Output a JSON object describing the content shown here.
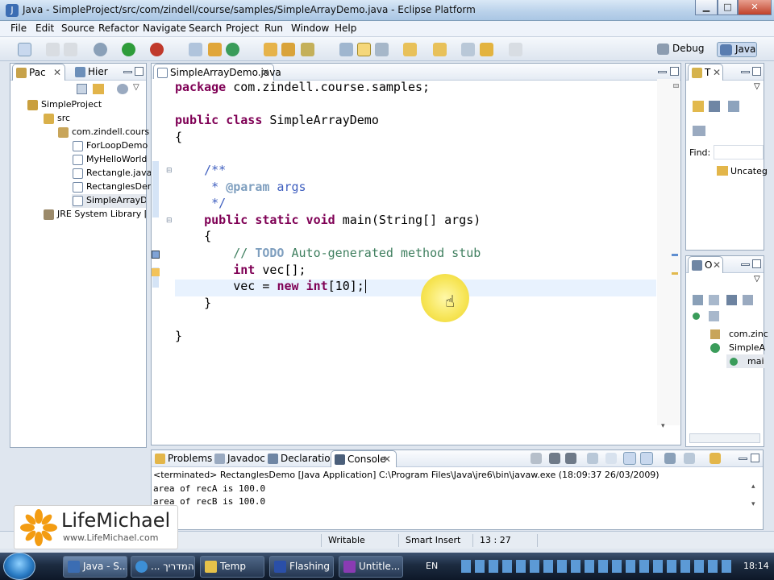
{
  "window": {
    "title": "Java - SimpleProject/src/com/zindell/course/samples/SimpleArrayDemo.java - Eclipse Platform",
    "minimize": "▁",
    "maximize": "□",
    "close": "✕"
  },
  "menu": [
    "File",
    "Edit",
    "Source",
    "Refactor",
    "Navigate",
    "Search",
    "Project",
    "Run",
    "Window",
    "Help"
  ],
  "perspectives": {
    "debug": "Debug",
    "java": "Java"
  },
  "package_explorer": {
    "tabs": [
      "Pac",
      "Hier"
    ],
    "tree": [
      {
        "label": "SimpleProject",
        "icon": "project-icon"
      },
      {
        "label": "src",
        "icon": "source-folder-icon"
      },
      {
        "label": "com.zindell.cours",
        "icon": "package-icon"
      },
      {
        "label": "ForLoopDemo",
        "icon": "java-file-icon"
      },
      {
        "label": "MyHelloWorld",
        "icon": "java-file-icon"
      },
      {
        "label": "Rectangle.java",
        "icon": "java-file-icon"
      },
      {
        "label": "RectanglesDer",
        "icon": "java-file-icon"
      },
      {
        "label": "SimpleArrayDe",
        "icon": "java-file-icon"
      },
      {
        "label": "JRE System Library [jre",
        "icon": "library-icon"
      }
    ]
  },
  "editor": {
    "tab": "SimpleArrayDemo.java",
    "code": {
      "l1_kw": "package",
      "l1_rest": " com.zindell.course.samples;",
      "l3_kw": "public class",
      "l3_rest": " SimpleArrayDemo",
      "l4": "{",
      "l6": "    /**",
      "l7_star": "     * ",
      "l7_tag": "@param",
      "l7_rest": " args",
      "l8": "     */",
      "l9_kw": "public static void",
      "l9_rest": " main(String[] args)",
      "l10": "    {",
      "l11_cm": "// ",
      "l11_todo": "TODO",
      "l11_rest": " Auto-generated method stub",
      "l12_kw": "int",
      "l12_rest": " vec[];",
      "l13_a": "vec = ",
      "l13_kw1": "new",
      "l13_sp": " ",
      "l13_kw2": "int",
      "l13_rest": "[10];",
      "l14": "    }",
      "l16": "}"
    }
  },
  "task_list": {
    "tab": "T",
    "find_label": "Find:",
    "item": "Uncateg"
  },
  "outline": {
    "tab": "O",
    "items": [
      "com.zinc",
      "SimpleA",
      "mai"
    ]
  },
  "bottom_tabs": [
    "Problems",
    "Javadoc",
    "Declaration",
    "Console"
  ],
  "console": {
    "header": "<terminated> RectanglesDemo [Java Application] C:\\Program Files\\Java\\jre6\\bin\\javaw.exe (18:09:37 26/03/2009)",
    "lines": [
      "area of recA is 100.0",
      "area of recB is 100.0"
    ]
  },
  "status": {
    "writable": "Writable",
    "insert": "Smart Insert",
    "position": "13 : 27"
  },
  "watermark": {
    "name": "LifeMichael",
    "url": "www.LifeMichael.com"
  },
  "taskbar": {
    "tasks": [
      "Java - S...",
      "... המדריך",
      "Temp",
      "Flashing",
      "Untitle..."
    ],
    "lang": "EN",
    "clock": "18:14"
  },
  "colors": {
    "keyword": "#7f0055",
    "comment": "#3f7f5f",
    "javadoc": "#3f5fbf",
    "current_line": "#e8f2fe"
  }
}
